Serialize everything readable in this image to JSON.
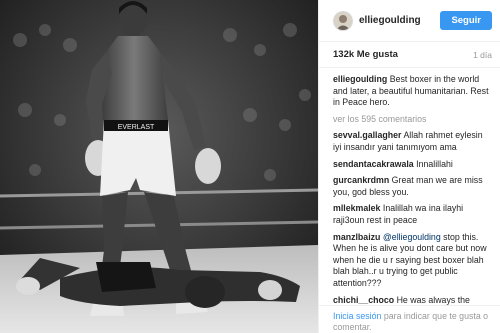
{
  "post": {
    "username": "elliegoulding",
    "follow_label": "Seguir",
    "likes": "132k Me gusta",
    "time_ago": "1 día",
    "caption": {
      "user": "elliegoulding",
      "text": "Best boxer in the world and later, a beautiful humanitarian. Rest in Peace hero."
    },
    "view_all": "ver los 595 comentarios",
    "comments": [
      {
        "user": "sevval.gallagher",
        "text": "Allah rahmet eylesin iyi insandır yani tanımıyom ama"
      },
      {
        "user": "sendantacakrawala",
        "text": "Innalillahi"
      },
      {
        "user": "gurcankrdmn",
        "text": "Great man we are miss you, god bless you."
      },
      {
        "user": "mllekmalek",
        "text": "Inalillah wa ina ilayhi raji3oun rest in peace"
      },
      {
        "user": "manzlbaizu",
        "mention": "@elliegoulding",
        "text": "stop this. When he is alive you dont care but now when he die u r saying best boxer blah blah blah..r u trying to get public attention???"
      },
      {
        "user": "chichi__choco",
        "text": "He was always the exempt of the good person the Muslims respect Ali ina lilah was ina ilayhi raji3on"
      }
    ],
    "footer": {
      "login": "Inicia sesión",
      "rest": "para indicar que te gusta o comentar."
    }
  },
  "photo": {
    "subject": "black-and-white boxing photograph",
    "ring_brand": "EVERLAST"
  },
  "colors": {
    "accent": "#3897f0",
    "muted": "#999999",
    "text": "#262626",
    "border": "#efefef"
  }
}
